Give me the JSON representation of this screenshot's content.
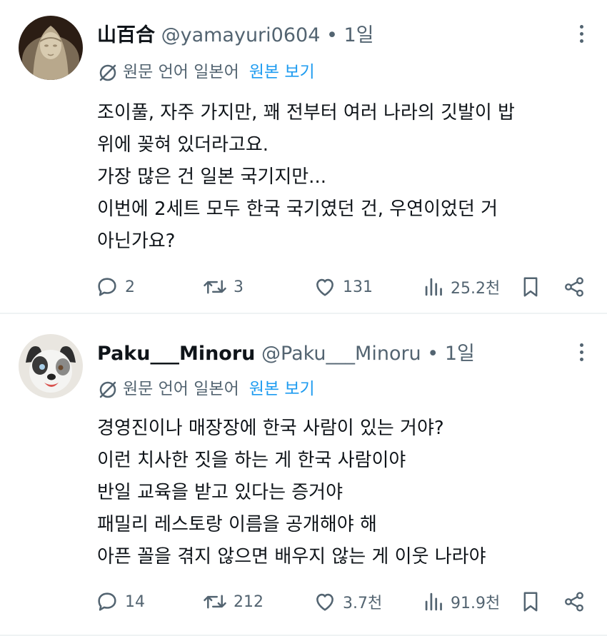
{
  "tweets": [
    {
      "name": "山百合",
      "handle": "@yamayuri0604",
      "time": "1일",
      "translate_note": "원문 언어 일본어",
      "show_original": "원본 보기",
      "lines": [
        "조이풀, 자주 가지만, 꽤 전부터 여러 나라의 깃발이 밥",
        "위에 꽂혀 있더라고요.",
        "가장 많은 건 일본 국기지만...",
        "이번에 2세트 모두 한국 국기였던 건, 우연이었던 거",
        "아닌가요?"
      ],
      "replies": "2",
      "retweets": "3",
      "likes": "131",
      "views": "25.2천"
    },
    {
      "name": "Paku___Minoru",
      "handle": "@Paku___Minoru",
      "time": "1일",
      "translate_note": "원문 언어 일본어",
      "show_original": "원본 보기",
      "lines": [
        "경영진이나 매장장에 한국 사람이 있는 거야?",
        "이런 치사한 짓을 하는 게 한국 사람이야",
        "반일 교육을 받고 있다는 증거야",
        "패밀리 레스토랑 이름을 공개해야 해",
        "아픈 꼴을 겪지 않으면 배우지 않는 게 이웃 나라야"
      ],
      "replies": "14",
      "retweets": "212",
      "likes": "3.7천",
      "views": "91.9천"
    }
  ],
  "icons": {
    "reply": "reply-icon",
    "retweet": "retweet-icon",
    "like": "heart-icon",
    "views": "views-icon",
    "bookmark": "bookmark-icon",
    "share": "share-icon",
    "translate": "translate-off-icon",
    "more": "more-dots-icon"
  },
  "colors": {
    "text": "#0f1419",
    "secondary": "#536471",
    "link": "#1d9bf0",
    "divider": "#eff3f4"
  }
}
